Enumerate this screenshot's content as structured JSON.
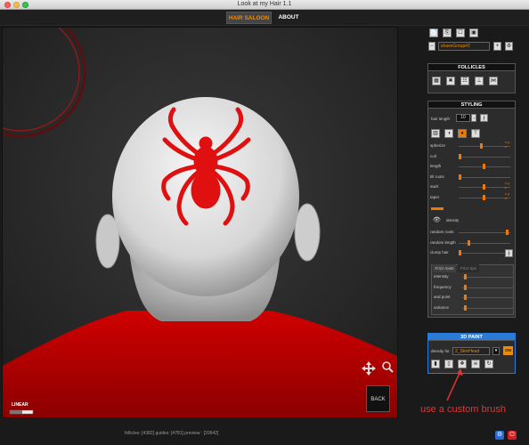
{
  "window": {
    "title": "Look at my Hair 1.1"
  },
  "tabs": [
    {
      "label": "HAIR SALOON",
      "active": true
    },
    {
      "label": "ABOUT",
      "active": false
    }
  ],
  "viewport": {
    "back_label": "BACK",
    "linear_label": "LINEAR"
  },
  "status": {
    "text": "follicles: [4382]  guides: [4781]   preview : [20642]"
  },
  "group": {
    "selected": "shaveGroup#2"
  },
  "follicles": {
    "title": "FOLLICLES"
  },
  "styling": {
    "title": "STYLING",
    "hair_length_label": "hair length",
    "hair_length_value": "10",
    "sliders": [
      {
        "label": "spherize",
        "value": 0.42,
        "mark": "x y z"
      },
      {
        "label": "curl",
        "value": 0.0,
        "mark": ""
      },
      {
        "label": "length",
        "value": 0.48,
        "mark": ""
      },
      {
        "label": "tilt roots",
        "value": 0.0,
        "mark": ""
      },
      {
        "label": "swirl",
        "value": 0.48,
        "mark": "x y z"
      },
      {
        "label": "taper",
        "value": 0.48,
        "mark": "x y z"
      }
    ],
    "density_label": "density",
    "lower_sliders": [
      {
        "label": "random roots",
        "value": 0.95
      },
      {
        "label": "random length",
        "value": 0.18
      },
      {
        "label": "clump hair",
        "value": 0.0
      }
    ],
    "frizz_tabs": [
      "Frizz roots",
      "Frizz tips"
    ],
    "frizz_sliders": [
      {
        "label": "intensity",
        "value": 0.03
      },
      {
        "label": "frequency",
        "value": 0.03
      },
      {
        "label": "and point",
        "value": 0.03
      },
      {
        "label": "variance",
        "value": 0.03
      }
    ]
  },
  "paint": {
    "title": "3D PAINT",
    "density_for_label": "density for",
    "density_for_value": "2_SkinHead",
    "on_label": "ON"
  },
  "annotation": {
    "text": "use a custom brush"
  },
  "colors": {
    "accent": "#f08a00",
    "paint_header": "#2a7ad8",
    "shirt": "#c40000",
    "spider": "#e01010"
  }
}
